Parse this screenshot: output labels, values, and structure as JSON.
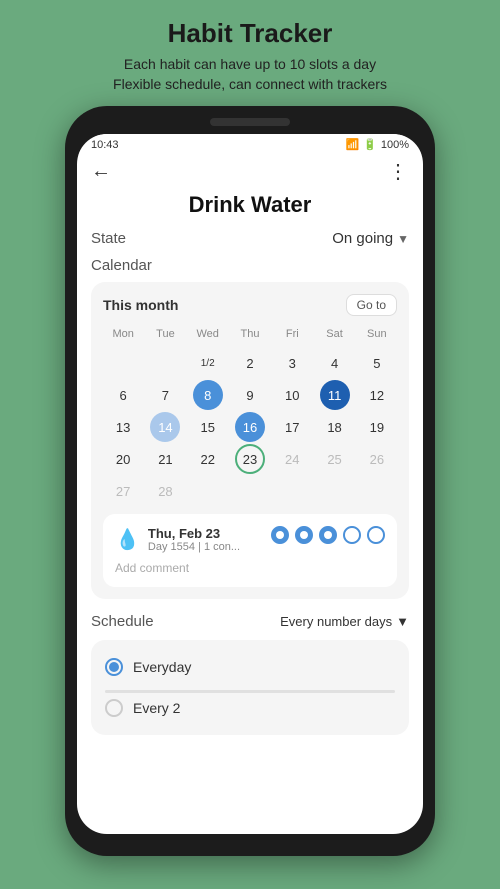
{
  "app": {
    "title": "Habit Tracker",
    "subtitle_line1": "Each habit can have up to 10 slots a day",
    "subtitle_line2": "Flexible schedule, can connect with trackers"
  },
  "status_bar": {
    "time": "10:43",
    "battery": "100%"
  },
  "nav": {
    "back_icon": "←",
    "more_icon": "⋮"
  },
  "page": {
    "title": "Drink Water"
  },
  "state_row": {
    "label": "State",
    "value": "On going",
    "chevron": "▼"
  },
  "calendar_section": {
    "label": "Calendar",
    "month": "This month",
    "goto_label": "Go to",
    "day_headers": [
      "Mon",
      "Tue",
      "Wed",
      "Thu",
      "Fri",
      "Sat",
      "Sun"
    ],
    "weeks": [
      [
        {
          "num": "1/2",
          "style": "small-text",
          "col": 3
        },
        {
          "num": "2",
          "style": ""
        },
        {
          "num": "3",
          "style": ""
        },
        {
          "num": "4",
          "style": ""
        },
        {
          "num": "5",
          "style": ""
        }
      ],
      [
        {
          "num": "6",
          "style": ""
        },
        {
          "num": "7",
          "style": ""
        },
        {
          "num": "8",
          "style": "filled-blue"
        },
        {
          "num": "9",
          "style": ""
        },
        {
          "num": "10",
          "style": ""
        },
        {
          "num": "11",
          "style": "filled-dark-blue"
        },
        {
          "num": "12",
          "style": ""
        }
      ],
      [
        {
          "num": "13",
          "style": ""
        },
        {
          "num": "14",
          "style": "filled-light-blue"
        },
        {
          "num": "15",
          "style": ""
        },
        {
          "num": "16",
          "style": "filled-blue"
        },
        {
          "num": "17",
          "style": ""
        },
        {
          "num": "18",
          "style": ""
        },
        {
          "num": "19",
          "style": ""
        }
      ],
      [
        {
          "num": "20",
          "style": ""
        },
        {
          "num": "21",
          "style": ""
        },
        {
          "num": "22",
          "style": ""
        },
        {
          "num": "23",
          "style": "today-outline"
        },
        {
          "num": "24",
          "style": "gray"
        },
        {
          "num": "25",
          "style": "gray"
        },
        {
          "num": "26",
          "style": "gray"
        }
      ],
      [
        {
          "num": "27",
          "style": "gray"
        },
        {
          "num": "28",
          "style": "gray"
        }
      ]
    ]
  },
  "day_detail": {
    "date": "Thu, Feb 23",
    "subtitle": "Day 1554 | 1 con...",
    "add_comment": "Add comment",
    "circles": [
      {
        "type": "checked"
      },
      {
        "type": "checked"
      },
      {
        "type": "checked"
      },
      {
        "type": "empty"
      },
      {
        "type": "empty"
      }
    ]
  },
  "schedule_section": {
    "label": "Schedule",
    "value": "Every number days",
    "chevron": "▼",
    "options": [
      {
        "label": "Everyday",
        "selected": true
      },
      {
        "label": "Every 2",
        "selected": false
      }
    ]
  }
}
